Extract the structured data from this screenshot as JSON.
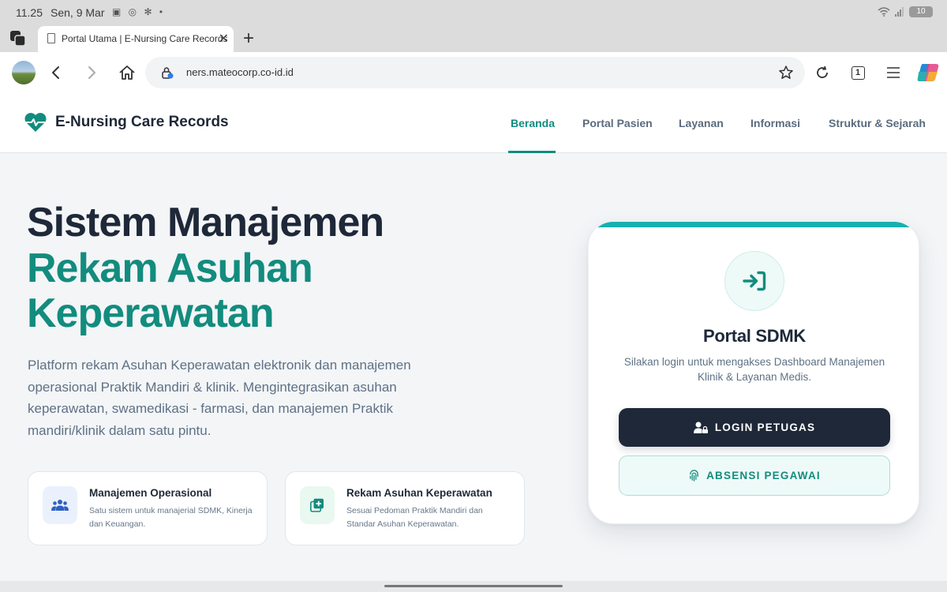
{
  "status_bar": {
    "time": "11.25",
    "date": "Sen, 9 Mar",
    "battery": "10"
  },
  "browser": {
    "tab_title": "Portal Utama | E-Nursing Care Records",
    "url": "ners.mateocorp.co-id.id",
    "tab_count": "1"
  },
  "site": {
    "brand": "E-Nursing Care Records",
    "nav": [
      "Beranda",
      "Portal Pasien",
      "Layanan",
      "Informasi",
      "Struktur & Sejarah"
    ],
    "active_nav": "Beranda"
  },
  "hero": {
    "line1": "Sistem Manajemen",
    "line2": "Rekam Asuhan",
    "line3": "Keperawatan",
    "description": "Platform rekam Asuhan Keperawatan elektronik dan manajemen operasional Praktik Mandiri & klinik. Mengintegrasikan asuhan keperawatan, swamedikasi - farmasi, dan manajemen Praktik mandiri/klinik dalam satu pintu."
  },
  "features": [
    {
      "title": "Manajemen Operasional",
      "desc": "Satu sistem untuk manajerial SDMK, Kinerja dan Keuangan.",
      "icon": "users-icon"
    },
    {
      "title": "Rekam Asuhan Keperawatan",
      "desc": "Sesuai Pedoman Praktik Mandiri dan Standar Asuhan Keperawatan.",
      "icon": "medical-record-icon"
    }
  ],
  "portal": {
    "title": "Portal SDMK",
    "subtitle": "Silakan login untuk mengakses Dashboard Manajemen Klinik & Layanan Medis.",
    "login_label": "LOGIN PETUGAS",
    "absen_label": "ABSENSI PEGAWAI"
  },
  "colors": {
    "teal": "#128c7e",
    "navy": "#1e2838",
    "accent": "#16b0b0"
  }
}
